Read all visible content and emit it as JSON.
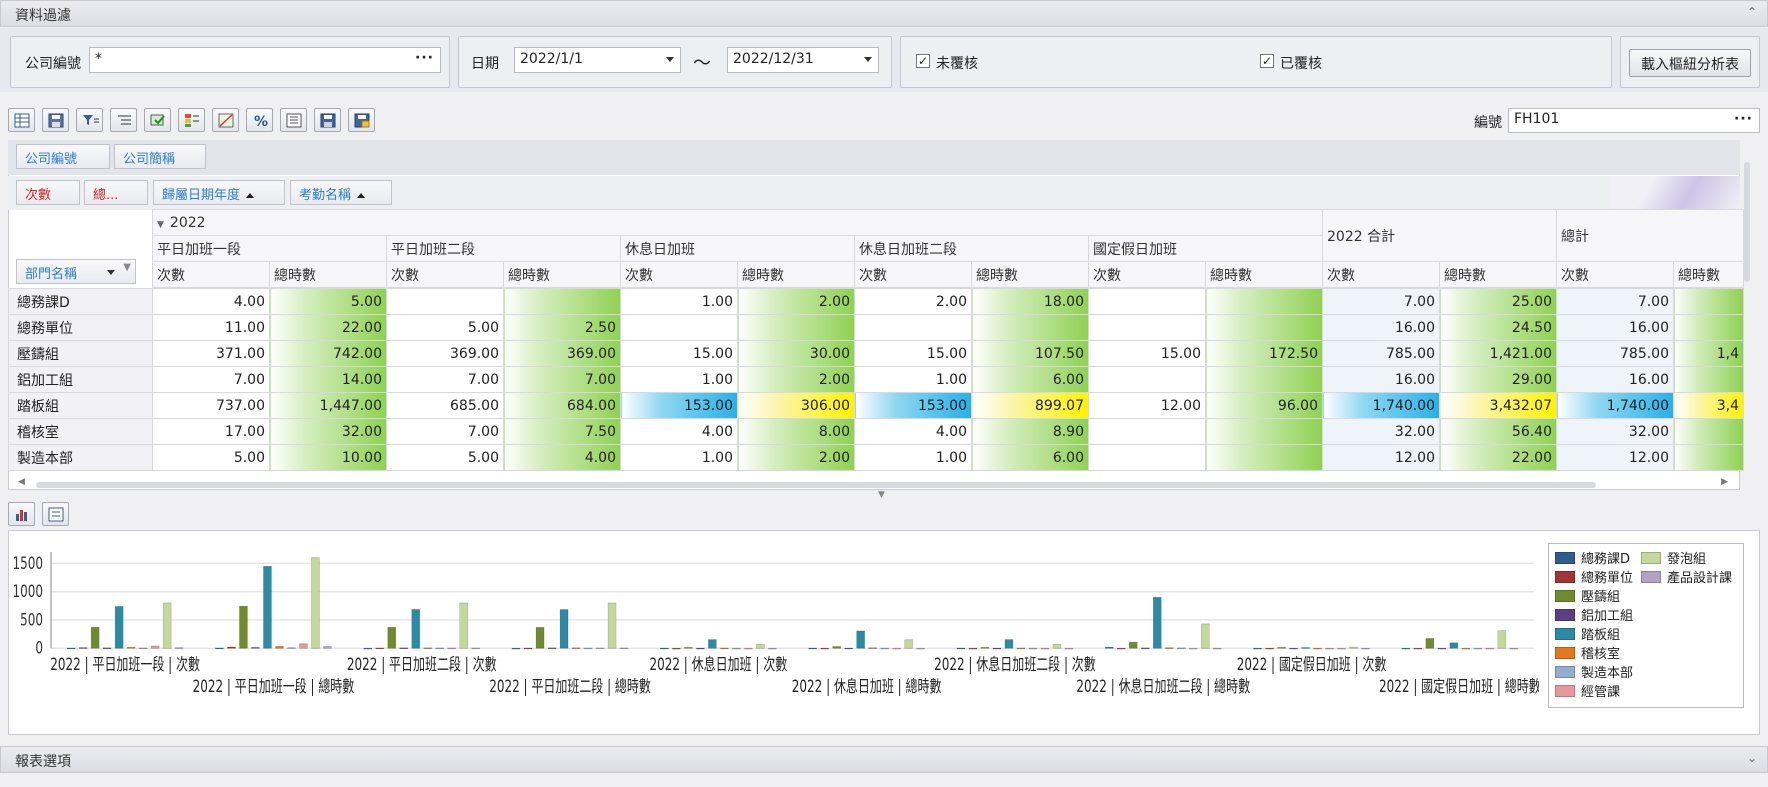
{
  "filter_panel": {
    "title": "資料過濾"
  },
  "filters": {
    "company_label": "公司編號",
    "company_value": "*",
    "date_label": "日期",
    "date_from": "2022/1/1",
    "date_to": "2022/12/31",
    "tilde": "～",
    "unreviewed_label": "未覆核",
    "unreviewed_checked": "✓",
    "reviewed_label": "已覆核",
    "reviewed_checked": "✓",
    "load_button": "載入樞紐分析表"
  },
  "toolbar": {
    "number_label": "編號",
    "number_value": "FH101",
    "icons": [
      "grid-icon",
      "save-layout-icon",
      "filter-icon",
      "list-icon",
      "export-icon",
      "conditional-format-icon",
      "chart-format-icon",
      "percent-icon",
      "field-list-icon",
      "save-icon",
      "save-as-icon"
    ]
  },
  "pivot": {
    "filter_fields": [
      "公司編號",
      "公司簡稱"
    ],
    "data_fields": [
      "次數",
      "總..."
    ],
    "column_fields": [
      "歸屬日期年度",
      "考勤名稱"
    ],
    "row_field": "部門名稱",
    "year": "2022",
    "groups": [
      "平日加班一段",
      "平日加班二段",
      "休息日加班",
      "休息日加班二段",
      "國定假日加班"
    ],
    "year_total": "2022 合計",
    "grand_total": "總計",
    "measure_count": "次數",
    "measure_hours": "總時數",
    "rows": [
      {
        "name": "總務課D",
        "cells": [
          "4.00",
          "5.00",
          "",
          "",
          "1.00",
          "2.00",
          "2.00",
          "18.00",
          "",
          "",
          "7.00",
          "25.00",
          "7.00",
          ""
        ]
      },
      {
        "name": "總務單位",
        "cells": [
          "11.00",
          "22.00",
          "5.00",
          "2.50",
          "",
          "",
          "",
          "",
          "",
          "",
          "16.00",
          "24.50",
          "16.00",
          ""
        ]
      },
      {
        "name": "壓鑄組",
        "cells": [
          "371.00",
          "742.00",
          "369.00",
          "369.00",
          "15.00",
          "30.00",
          "15.00",
          "107.50",
          "15.00",
          "172.50",
          "785.00",
          "1,421.00",
          "785.00",
          "1,4"
        ]
      },
      {
        "name": "鋁加工組",
        "cells": [
          "7.00",
          "14.00",
          "7.00",
          "7.00",
          "1.00",
          "2.00",
          "1.00",
          "6.00",
          "",
          "",
          "16.00",
          "29.00",
          "16.00",
          ""
        ]
      },
      {
        "name": "踏板組",
        "cells": [
          "737.00",
          "1,447.00",
          "685.00",
          "684.00",
          "153.00",
          "306.00",
          "153.00",
          "899.07",
          "12.00",
          "96.00",
          "1,740.00",
          "3,432.07",
          "1,740.00",
          "3,4"
        ]
      },
      {
        "name": "稽核室",
        "cells": [
          "17.00",
          "32.00",
          "7.00",
          "7.50",
          "4.00",
          "8.00",
          "4.00",
          "8.90",
          "",
          "",
          "32.00",
          "56.40",
          "32.00",
          ""
        ]
      },
      {
        "name": "製造本部",
        "cells": [
          "5.00",
          "10.00",
          "5.00",
          "4.00",
          "1.00",
          "2.00",
          "1.00",
          "6.00",
          "",
          "",
          "12.00",
          "22.00",
          "12.00",
          ""
        ]
      }
    ]
  },
  "chart_data": {
    "type": "bar",
    "ylim": [
      0,
      1700
    ],
    "yticks": [
      0,
      500,
      1000,
      1500
    ],
    "categories": [
      "2022 | 平日加班一段 | 次數",
      "2022 | 平日加班一段 | 總時數",
      "2022 | 平日加班二段 | 次數",
      "2022 | 平日加班二段 | 總時數",
      "2022 | 休息日加班 | 次數",
      "2022 | 休息日加班 | 總時數",
      "2022 | 休息日加班二段 | 次數",
      "2022 | 休息日加班二段 | 總時數",
      "2022 | 國定假日加班 | 次數",
      "2022 | 國定假日加班 | 總時數"
    ],
    "series": [
      {
        "name": "總務課D",
        "color": "#2f5c8f",
        "values": [
          4,
          5,
          0,
          0,
          1,
          2,
          2,
          18,
          0,
          0
        ]
      },
      {
        "name": "總務單位",
        "color": "#a33435",
        "values": [
          11,
          22,
          5,
          2.5,
          0,
          0,
          0,
          0,
          0,
          0
        ]
      },
      {
        "name": "壓鑄組",
        "color": "#6e8b2e",
        "values": [
          371,
          742,
          369,
          369,
          15,
          30,
          15,
          107.5,
          15,
          172.5
        ]
      },
      {
        "name": "鋁加工組",
        "color": "#5a3f86",
        "values": [
          7,
          14,
          7,
          7,
          1,
          2,
          1,
          6,
          0,
          0
        ]
      },
      {
        "name": "踏板組",
        "color": "#2a8ba7",
        "values": [
          737,
          1447,
          685,
          684,
          153,
          306,
          153,
          899.07,
          12,
          96
        ]
      },
      {
        "name": "稽核室",
        "color": "#e6771e",
        "values": [
          17,
          32,
          7,
          7.5,
          4,
          8,
          4,
          8.9,
          0,
          0
        ]
      },
      {
        "name": "製造本部",
        "color": "#92add1",
        "values": [
          5,
          10,
          5,
          4,
          1,
          2,
          1,
          6,
          0,
          0
        ]
      },
      {
        "name": "經管課",
        "color": "#e6999a",
        "values": [
          40,
          80,
          5,
          5,
          0,
          0,
          0,
          0,
          0,
          0
        ]
      },
      {
        "name": "發泡組",
        "color": "#c3d89a",
        "values": [
          800,
          1600,
          800,
          800,
          70,
          150,
          70,
          430,
          20,
          310
        ]
      },
      {
        "name": "產品設計課",
        "color": "#b3a2c8",
        "values": [
          10,
          30,
          5,
          5,
          0,
          0,
          0,
          0,
          0,
          0
        ]
      }
    ]
  },
  "report_panel": {
    "title": "報表選項"
  }
}
